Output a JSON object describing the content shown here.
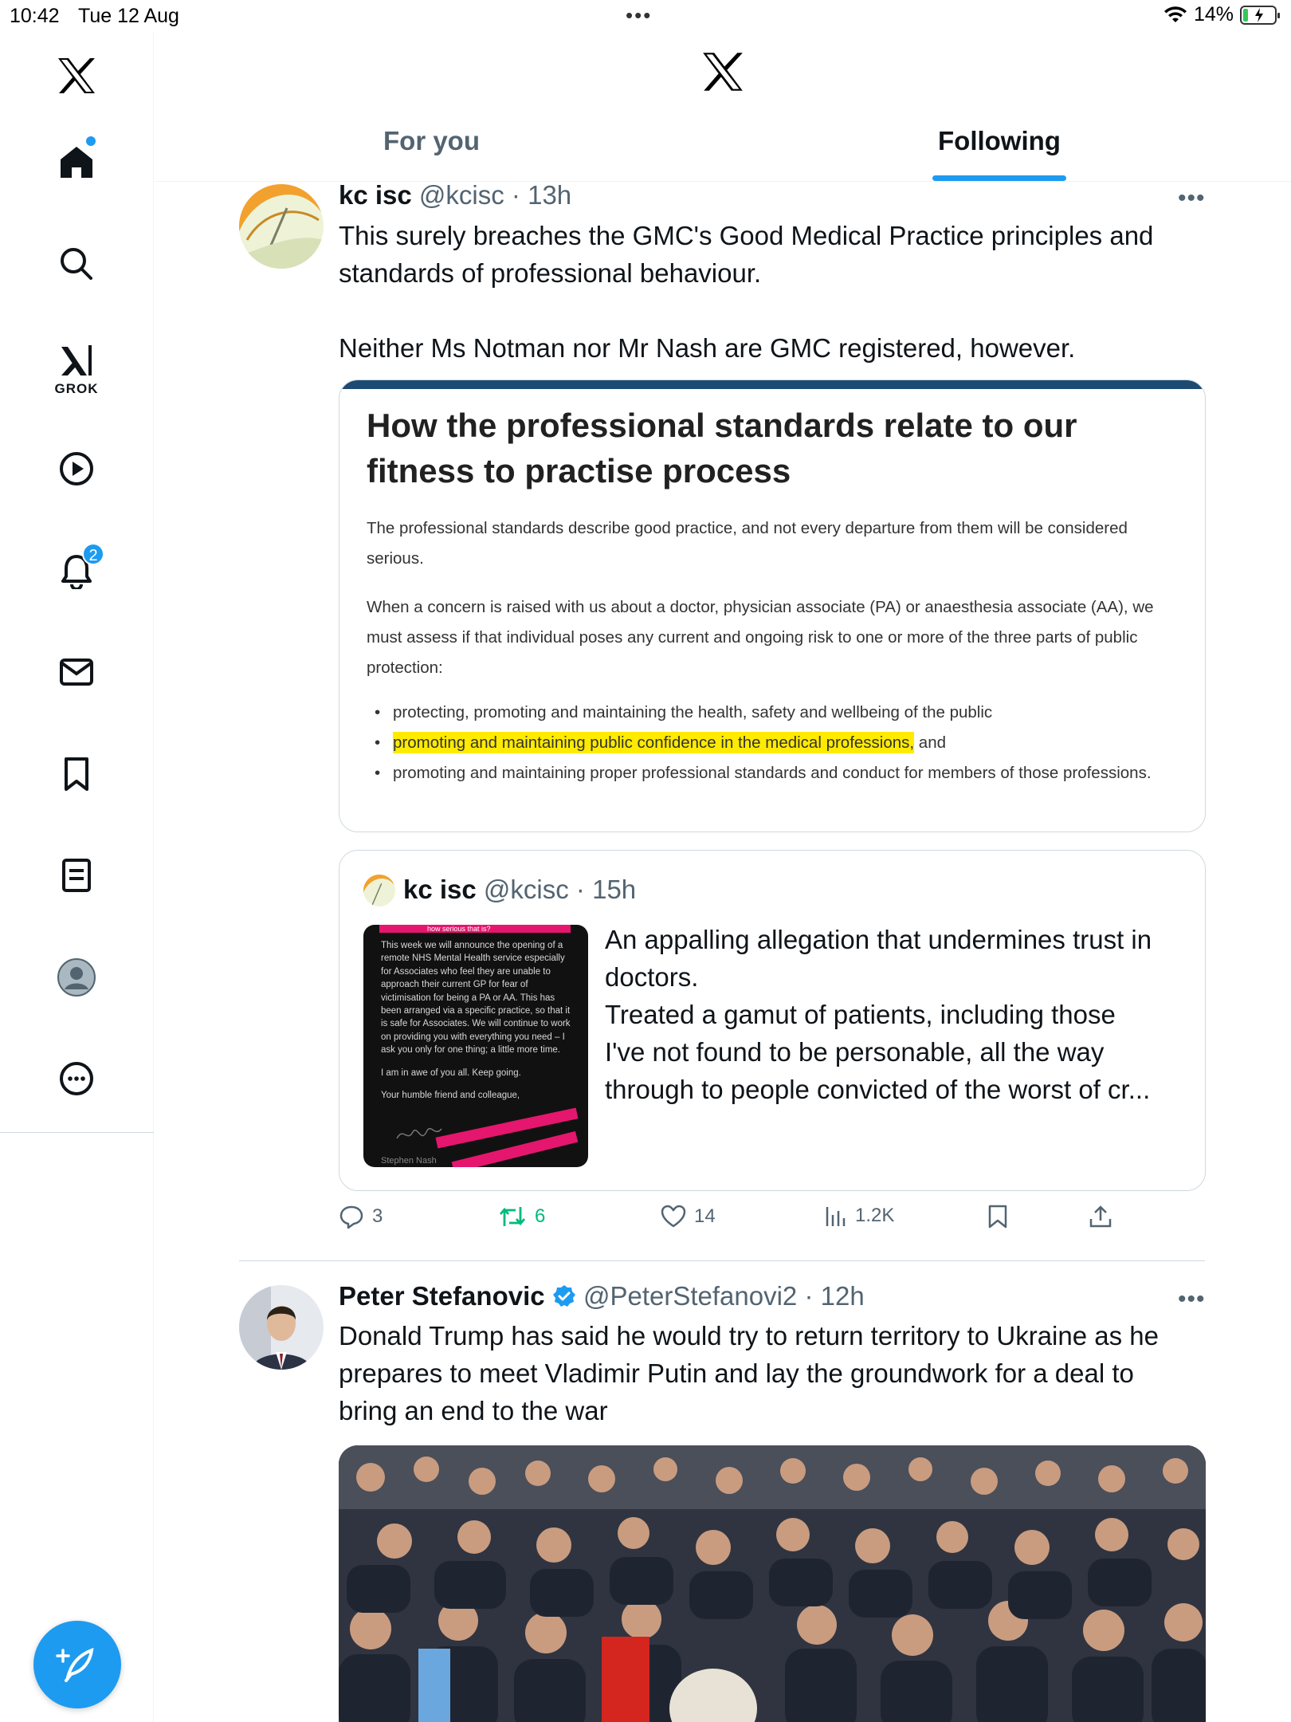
{
  "status_bar": {
    "time": "10:42",
    "date": "Tue 12 Aug",
    "battery": "14%",
    "battery_fraction": 0.14
  },
  "sidebar": {
    "items": [
      {
        "icon": "home-icon",
        "active": true,
        "has_dot": true
      },
      {
        "icon": "search-icon"
      },
      {
        "icon": "grok-icon",
        "label": "GROK"
      },
      {
        "icon": "video-icon"
      },
      {
        "icon": "notifications-icon",
        "badge": "2"
      },
      {
        "icon": "messages-icon"
      },
      {
        "icon": "bookmarks-icon"
      },
      {
        "icon": "lists-icon"
      },
      {
        "icon": "profile-icon"
      },
      {
        "icon": "more-icon"
      }
    ],
    "compose_icon": "compose-icon"
  },
  "header": {
    "logo": "x-logo-icon",
    "tabs": [
      {
        "label": "For you",
        "active": false
      },
      {
        "label": "Following",
        "active": true
      }
    ]
  },
  "colors": {
    "accent": "#1d9bf0",
    "text": "#0f1419",
    "secondary": "#536471",
    "retweet": "#00ba7c",
    "highlight": "#ffeb00"
  },
  "posts": [
    {
      "name": "kc isc",
      "handle": "@kcisc",
      "time": "13h",
      "text_line1": "This surely breaches the GMC's Good Medical Practice principles and",
      "text_line2": "standards of professional behaviour.",
      "text_line3": "Neither Ms Notman nor Mr Nash are GMC registered, however.",
      "card": {
        "heading": "How the professional standards relate to our fitness to practise process",
        "para1": "The professional standards describe good practice, and not every departure from them will be considered serious.",
        "para2": "When a concern is raised with us about a doctor, physician associate (PA) or anaesthesia associate (AA), we must assess if that individual poses any current and ongoing risk to one or more of the three parts of public protection:",
        "bullet1": "protecting, promoting and maintaining the health, safety and wellbeing of the public",
        "bullet2_highlight": "promoting and maintaining public confidence in the medical professions,",
        "bullet2_rest": " and",
        "bullet3": "promoting and maintaining proper professional standards and conduct for members of those professions."
      },
      "quote": {
        "name": "kc isc",
        "handle": "@kcisc",
        "time": "15h",
        "image_caption": "how serious that is?",
        "image_text": "This week we will announce the opening of a remote NHS Mental Health service especially for Associates who feel they are unable to approach their current GP for fear of victimisation for being a PA or AA. This has been arranged via a specific practice, so that it is safe for Associates. We will continue to work on providing you with everything you need – I ask you only for one thing; a little more time.",
        "image_text2": "I am in awe of you all. Keep going.",
        "image_text3": "Your humble friend and colleague,",
        "image_signoff": "Stephen Nash",
        "text_line1": "An appalling allegation that undermines trust in",
        "text_line2": "doctors.",
        "text_line3": "Treated a gamut of patients, including those",
        "text_line4": "I've not found to be personable, all the way",
        "text_line5": "through to people convicted of the worst of cr..."
      },
      "actions": {
        "replies": "3",
        "reposts": "6",
        "likes": "14",
        "views": "1.2K"
      }
    },
    {
      "name": "Peter Stefanovic",
      "verified": true,
      "handle": "@PeterStefanovi2",
      "time": "12h",
      "text_line1": "Donald Trump has said he would try to return territory to Ukraine as he",
      "text_line2": "prepares to meet Vladimir Putin and lay the groundwork for a deal to",
      "text_line3": "bring an end to the war"
    }
  ]
}
